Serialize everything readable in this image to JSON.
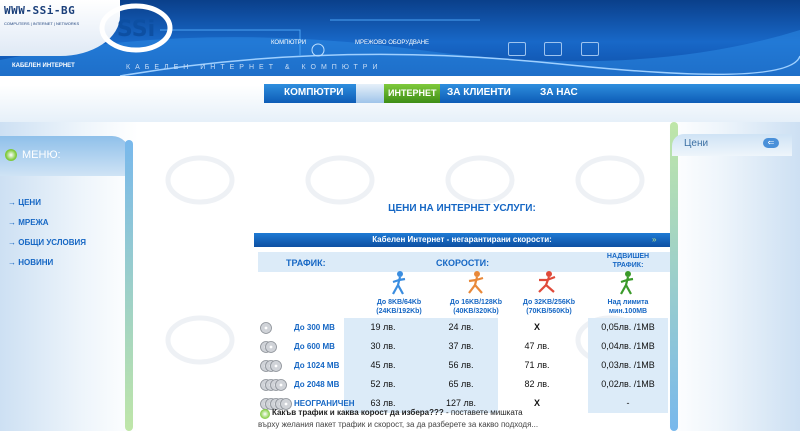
{
  "header": {
    "logo_text": "WWW-SSi-BG",
    "logo_tagline": "COMPUTERS | INTERNET | NETWORKS",
    "logo_mark": "SSi",
    "top_links": [
      "КОМПЮТРИ",
      "МРЕЖОВО ОБОРУДВАНЕ"
    ],
    "section_label": "КАБЕЛЕН ИНТЕРНЕТ",
    "scroll_text": "КАБЕЛЕН ИНТЕРНЕТ & КОМПЮТРИ"
  },
  "nav": {
    "items": [
      "КОМПЮТРИ",
      "ИНТЕРНЕТ",
      "ЗА КЛИЕНТИ",
      "ЗА НАС"
    ],
    "active_index": 1
  },
  "sidebar": {
    "title": "МЕНЮ:",
    "items": [
      "ЦЕНИ",
      "МРЕЖА",
      "ОБЩИ УСЛОВИЯ",
      "НОВИНИ"
    ]
  },
  "right_panel": {
    "label": "Цени"
  },
  "main": {
    "title": "ЦЕНИ НА ИНТЕРНЕТ УСЛУГИ:",
    "table_title": "Кабелен Интернет - негарантирани скорости:",
    "head_traffic": "ТРАФИК:",
    "head_speeds": "СКОРОСТИ:",
    "head_over_line1": "НАДВИШЕН",
    "head_over_line2": "ТРАФИК:",
    "speeds": [
      {
        "line1": "До 8KB/64Kb",
        "line2": "(24KB/192Kb)",
        "color": "#3a8de0"
      },
      {
        "line1": "До 16KB/128Kb",
        "line2": "(40KB/320Kb)",
        "color": "#e8893a"
      },
      {
        "line1": "До 32KB/256Kb",
        "line2": "(70KB/560Kb)",
        "color": "#e04a3a"
      }
    ],
    "over_caption_line1": "Над лимита",
    "over_caption_line2": "мин.100MB",
    "rows": [
      {
        "traffic": "До 300 MB",
        "discs": 1,
        "p1": "19 лв.",
        "p2": "24 лв.",
        "p3": "X",
        "over": "0,05лв. /1MB"
      },
      {
        "traffic": "До 600 MB",
        "discs": 2,
        "p1": "30 лв.",
        "p2": "37 лв.",
        "p3": "47 лв.",
        "over": "0,04лв. /1MB"
      },
      {
        "traffic": "До 1024 MB",
        "discs": 3,
        "p1": "45 лв.",
        "p2": "56 лв.",
        "p3": "71 лв.",
        "over": "0,03лв. /1MB"
      },
      {
        "traffic": "До 2048 MB",
        "discs": 4,
        "p1": "52 лв.",
        "p2": "65 лв.",
        "p3": "82 лв.",
        "over": "0,02лв. /1MB"
      },
      {
        "traffic": "НЕОГРАНИЧЕН",
        "discs": 5,
        "p1": "63 лв.",
        "p2": "127 лв.",
        "p3": "X",
        "over": "-"
      }
    ],
    "note_bold": "Какъв трафик и каква корост да избера???",
    "note_rest": " - поставете мишката",
    "note_line2": "върху желания пакет трафик и скорост, за да разберете за какво подходя..."
  },
  "colors": {
    "accent_blue": "#1667c4",
    "nav_active": "#5aa82a",
    "cross_red": "#e02020"
  }
}
